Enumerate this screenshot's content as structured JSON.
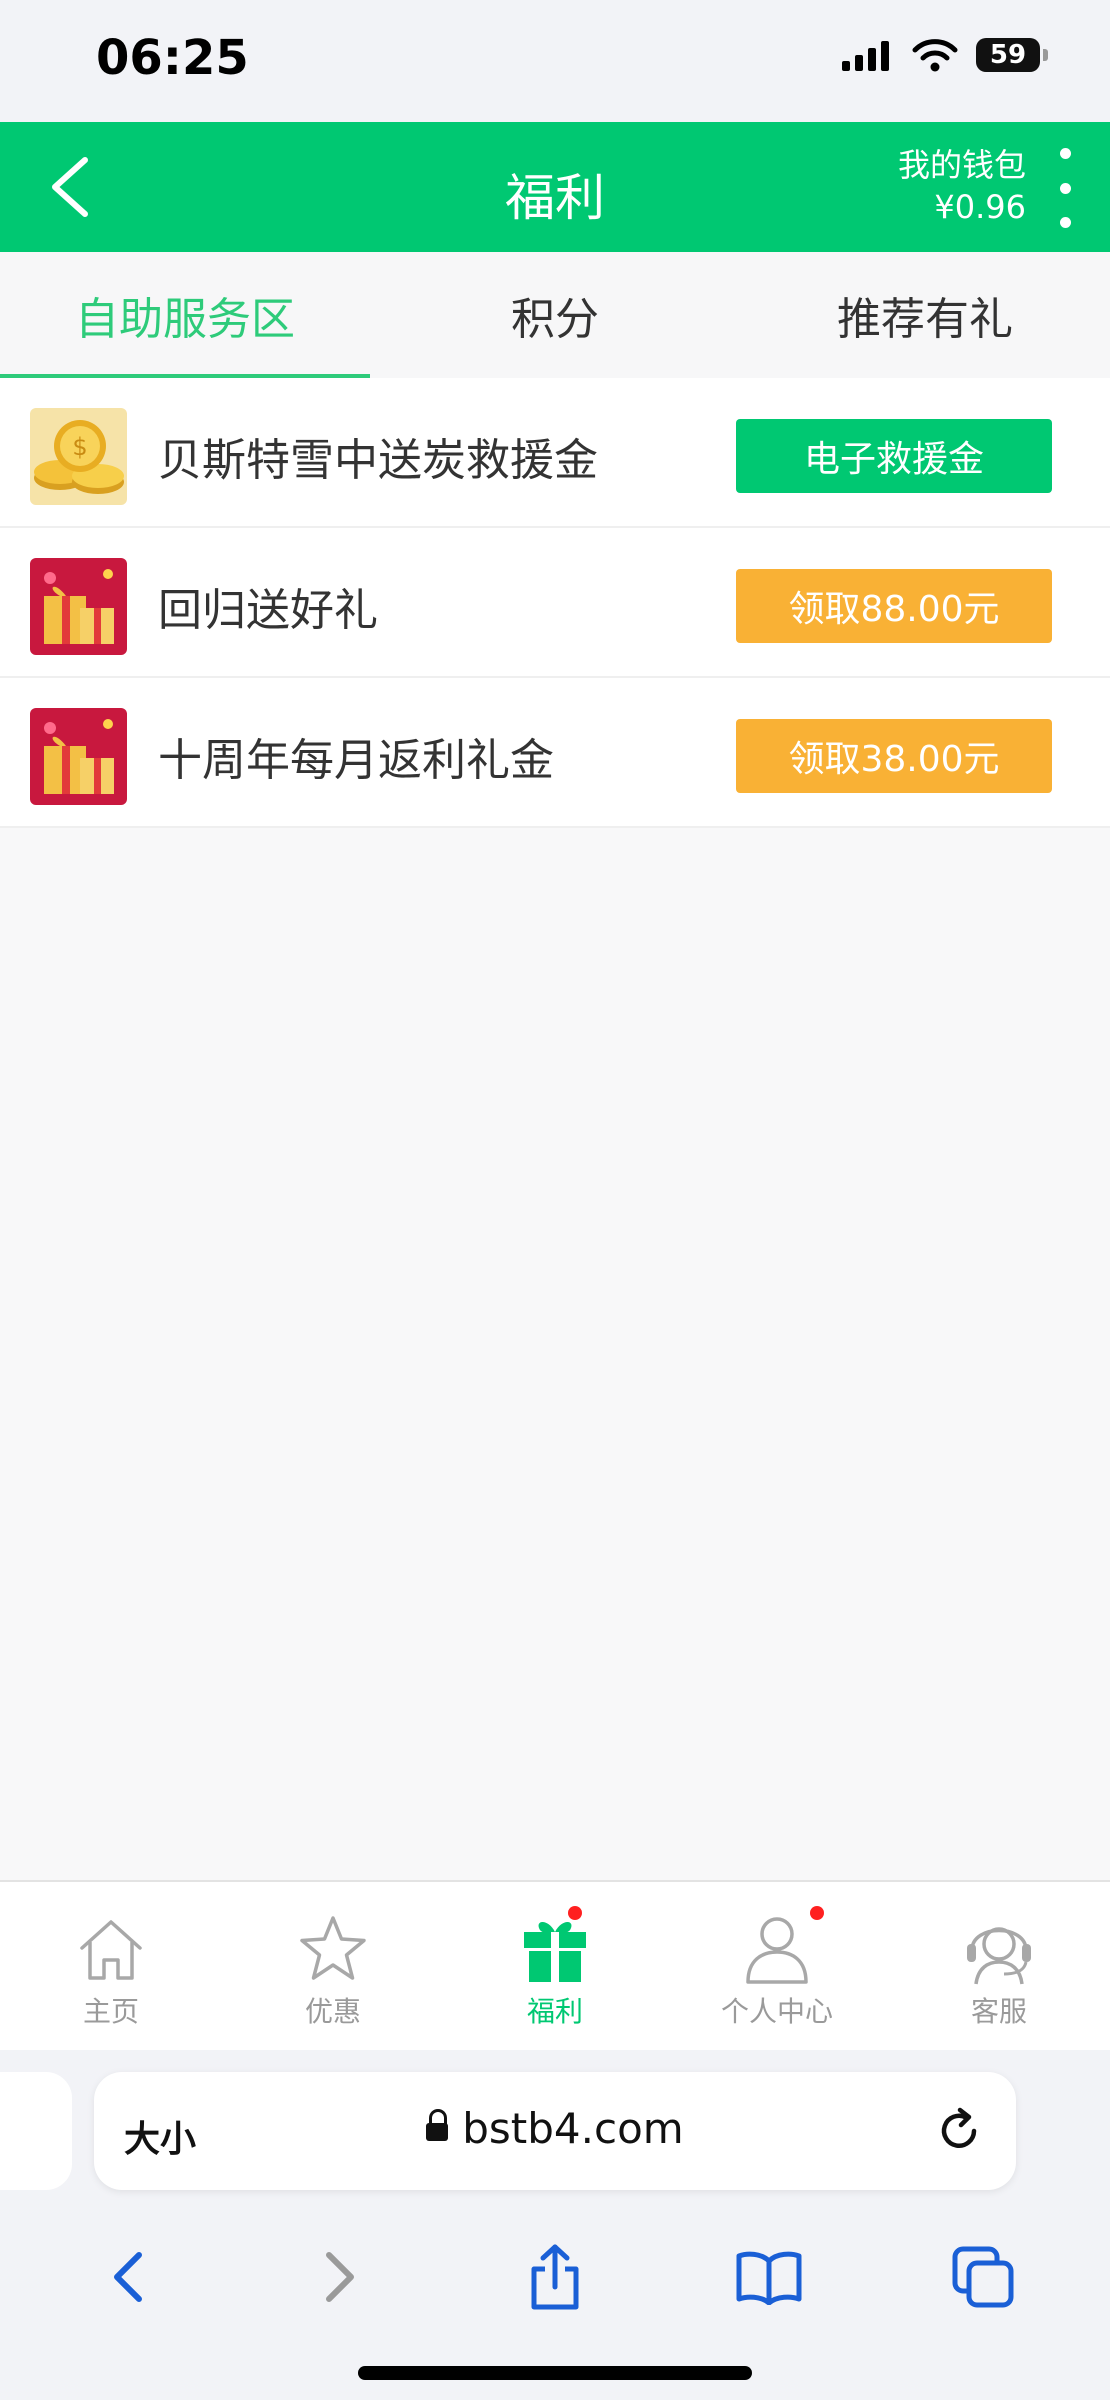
{
  "status_bar": {
    "time": "06:25",
    "battery": "59"
  },
  "header": {
    "title": "福利",
    "wallet_label": "我的钱包",
    "wallet_amount": "¥0.96"
  },
  "tabs": [
    {
      "label": "自助服务区",
      "active": true
    },
    {
      "label": "积分",
      "active": false
    },
    {
      "label": "推荐有礼",
      "active": false
    }
  ],
  "rewards": [
    {
      "title": "贝斯特雪中送炭救援金",
      "button": "电子救援金",
      "button_color": "#00c872",
      "icon": "gold-coins-icon"
    },
    {
      "title": "回归送好礼",
      "button": "领取88.00元",
      "button_color": "#f9b135",
      "icon": "gift-box-icon"
    },
    {
      "title": "十周年每月返利礼金",
      "button": "领取38.00元",
      "button_color": "#f9b135",
      "icon": "gift-box-icon"
    }
  ],
  "bottom_nav": [
    {
      "label": "主页",
      "icon": "home-icon"
    },
    {
      "label": "优惠",
      "icon": "star-icon"
    },
    {
      "label": "福利",
      "icon": "gift-icon",
      "active": true,
      "badge": true
    },
    {
      "label": "个人中心",
      "icon": "user-icon",
      "badge": true
    },
    {
      "label": "客服",
      "icon": "headset-icon"
    }
  ],
  "browser": {
    "text_size_label": "大小",
    "url": "bstb4.com"
  },
  "colors": {
    "brand_green": "#00c872",
    "tab_active": "#2ecb7a",
    "accent_orange": "#f9b135",
    "badge_red": "#ff2020"
  }
}
